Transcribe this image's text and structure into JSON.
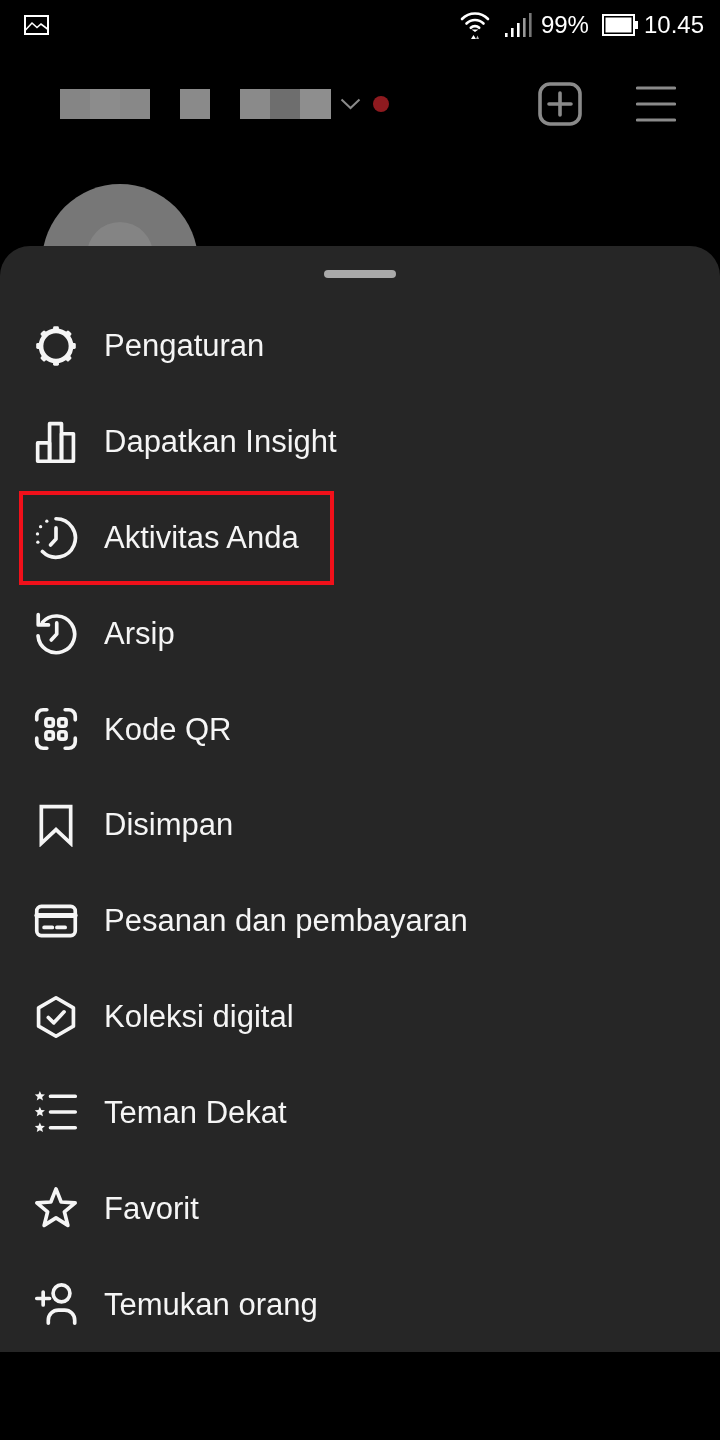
{
  "status_bar": {
    "battery": "99%",
    "time": "10.45"
  },
  "header": {
    "unread": true
  },
  "sheet": {
    "items": [
      {
        "label": "Pengaturan",
        "highlighted": false
      },
      {
        "label": "Dapatkan Insight",
        "highlighted": false
      },
      {
        "label": "Aktivitas Anda",
        "highlighted": true
      },
      {
        "label": "Arsip",
        "highlighted": false
      },
      {
        "label": "Kode QR",
        "highlighted": false
      },
      {
        "label": "Disimpan",
        "highlighted": false
      },
      {
        "label": "Pesanan dan pembayaran",
        "highlighted": false
      },
      {
        "label": "Koleksi digital",
        "highlighted": false
      },
      {
        "label": "Teman Dekat",
        "highlighted": false
      },
      {
        "label": "Favorit",
        "highlighted": false
      },
      {
        "label": "Temukan orang",
        "highlighted": false
      }
    ]
  }
}
